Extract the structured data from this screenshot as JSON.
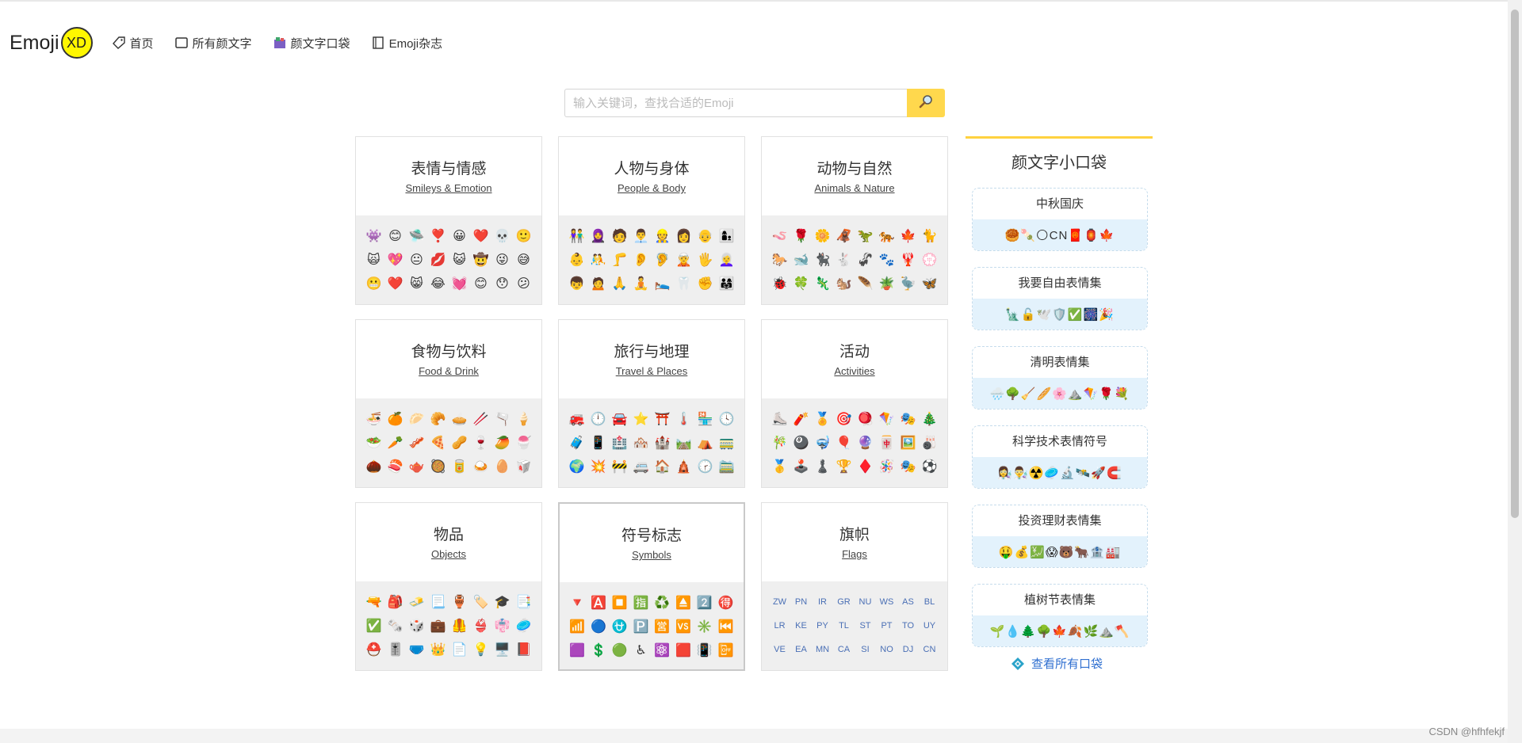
{
  "header": {
    "logo_text": "Emoji",
    "logo_badge": "XD",
    "nav": [
      {
        "label": "首页",
        "icon": "tag-icon"
      },
      {
        "label": "所有颜文字",
        "icon": "frame-icon"
      },
      {
        "label": "颜文字口袋",
        "icon": "pocket-icon"
      },
      {
        "label": "Emoji杂志",
        "icon": "book-icon"
      }
    ]
  },
  "search": {
    "placeholder": "输入关键词，查找合适的Emoji",
    "button_icon": "magnifier-icon"
  },
  "categories": [
    {
      "title": "表情与情感",
      "subtitle": "Smileys & Emotion",
      "emojis": [
        "👾",
        "😊",
        "🛸",
        "❣️",
        "😀",
        "❤️",
        "💀",
        "🙂",
        "🙀",
        "💖",
        "😐",
        "💋",
        "😺",
        "🤠",
        "😜",
        "😅",
        "😬",
        "❤️",
        "😸",
        "😂",
        "💓",
        "😊",
        "😯",
        "😕"
      ]
    },
    {
      "title": "人物与身体",
      "subtitle": "People & Body",
      "emojis": [
        "👫",
        "🧕",
        "🧑",
        "👨‍💼",
        "👷",
        "👩",
        "👴",
        "👩‍👦",
        "👶",
        "🤼",
        "🦵",
        "👂",
        "🦻",
        "🧝",
        "🖐️",
        "👩‍🦳",
        "👦",
        "🙍",
        "🙏",
        "🧘",
        "🛌",
        "🦷",
        "✊",
        "👨‍👩‍👧"
      ]
    },
    {
      "title": "动物与自然",
      "subtitle": "Animals & Nature",
      "emojis": [
        "🪱",
        "🌹",
        "🌼",
        "🦧",
        "🦖",
        "🐅",
        "🍁",
        "🐈",
        "🐎",
        "🐋",
        "🐈‍⬛",
        "🐇",
        "🦨",
        "🐾",
        "🦞",
        "💮",
        "🐞",
        "🍀",
        "🦎",
        "🐿️",
        "🪶",
        "🪴",
        "🦤",
        "🦋"
      ]
    },
    {
      "title": "食物与饮料",
      "subtitle": "Food & Drink",
      "emojis": [
        "🍜",
        "🍊",
        "🥟",
        "🥐",
        "🥧",
        "🥢",
        "🫗",
        "🍦",
        "🥗",
        "🥕",
        "🥓",
        "🍕",
        "🥜",
        "🍷",
        "🥭",
        "🍧",
        "🌰",
        "🍣",
        "🫖",
        "🥘",
        "🥫",
        "🍛",
        "🥚",
        "🥡"
      ]
    },
    {
      "title": "旅行与地理",
      "subtitle": "Travel & Places",
      "emojis": [
        "🚒",
        "🕛",
        "🚘",
        "⭐",
        "⛩️",
        "🌡️",
        "🏪",
        "🕓",
        "🧳",
        "📱",
        "🏥",
        "🏘️",
        "🏰",
        "🛤️",
        "⛺",
        "🚃",
        "🌍",
        "💥",
        "🚧",
        "🚐",
        "🏠",
        "🛕",
        "🕝",
        "🚞"
      ]
    },
    {
      "title": "活动",
      "subtitle": "Activities",
      "emojis": [
        "⛸️",
        "🧨",
        "🏅",
        "🎯",
        "🪀",
        "🪁",
        "🎭",
        "🎄",
        "🎋",
        "🎱",
        "🤿",
        "🎈",
        "🔮",
        "🀄",
        "🖼️",
        "🎳",
        "🥇",
        "🕹️",
        "♟️",
        "🏆",
        "♦️",
        "🪅",
        "🎭",
        "⚽"
      ]
    },
    {
      "title": "物品",
      "subtitle": "Objects",
      "emojis": [
        "🔫",
        "🎒",
        "🧈",
        "📃",
        "🏺",
        "🏷️",
        "🎓",
        "📑",
        "✅",
        "🗞️",
        "🎲",
        "💼",
        "🦺",
        "👙",
        "👘",
        "🥏",
        "⛑️",
        "🎚️",
        "🩲",
        "👑",
        "📄",
        "💡",
        "🖥️",
        "📕"
      ]
    },
    {
      "title": "符号标志",
      "subtitle": "Symbols",
      "emojis": [
        "🔻",
        "🅰️",
        "⏹️",
        "🈯",
        "♻️",
        "⏏️",
        "2️⃣",
        "🉐",
        "📶",
        "🔵",
        "⛎",
        "🅿️",
        "🈺",
        "🆚",
        "✳️",
        "⏮️",
        "🟪",
        "💲",
        "🟢",
        "♿",
        "⚛️",
        "🟥",
        "📳",
        "📴"
      ]
    },
    {
      "title": "旗帜",
      "subtitle": "Flags",
      "codes": [
        "ZW",
        "PN",
        "IR",
        "GR",
        "NU",
        "WS",
        "AS",
        "BL",
        "LR",
        "KE",
        "PY",
        "TL",
        "ST",
        "PT",
        "TO",
        "UY",
        "VE",
        "EA",
        "MN",
        "CA",
        "SI",
        "NO",
        "DJ",
        "CN"
      ]
    }
  ],
  "pocket": {
    "title": "颜文字小口袋",
    "items": [
      {
        "name": "中秋国庆",
        "emojis": "🥮🍡🌕CN🧧🏮🍁"
      },
      {
        "name": "我要自由表情集",
        "emojis": "🗽🔓🕊️🛡️✅🎆🎉"
      },
      {
        "name": "清明表情集",
        "emojis": "🌧️🌳🧹🥖🌸⛰️🪁🌹💐"
      },
      {
        "name": "科学技术表情符号",
        "emojis": "👩‍🔬👨‍🔬☢️🥏🔬🛰️🚀🧲"
      },
      {
        "name": "投资理财表情集",
        "emojis": "🤑💰💹😱🐻🐂🏦🏭"
      },
      {
        "name": "植树节表情集",
        "emojis": "🌱💧🌲🌳🍁🍂🌿⛰️🪓"
      }
    ],
    "view_all": "查看所有口袋"
  },
  "watermark": "CSDN @hfhfekjf",
  "colors": {
    "accent_yellow": "#ffd84d",
    "logo_yellow": "#fff700",
    "link_blue": "#2f6fd0",
    "pocket_bg": "#e3f2fc"
  }
}
